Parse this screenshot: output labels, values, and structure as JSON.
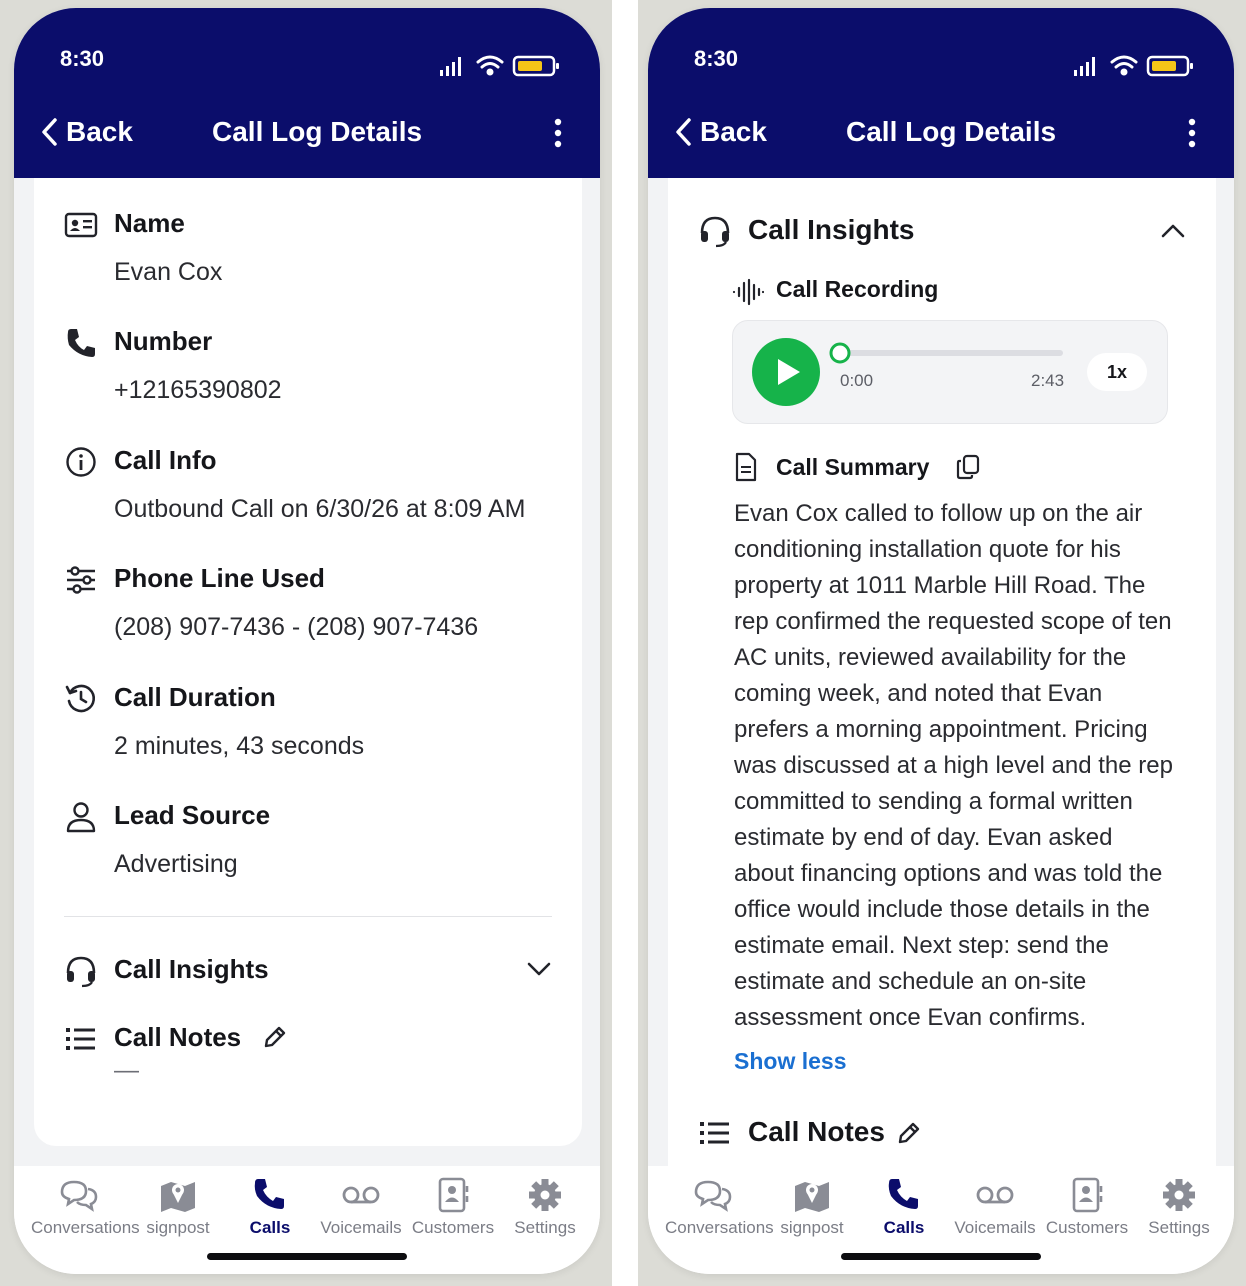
{
  "status": {
    "time": "8:30"
  },
  "nav": {
    "back_label": "Back",
    "title": "Call Log Details"
  },
  "details": {
    "name": {
      "label": "Name",
      "value": "Evan Cox"
    },
    "number": {
      "label": "Number",
      "value": "+12165390802"
    },
    "call_info": {
      "label": "Call Info",
      "value": "Outbound Call on 6/30/26 at 8:09 AM"
    },
    "phone_line": {
      "label": "Phone Line Used",
      "value": "(208) 907-7436 - (208) 907-7436"
    },
    "duration": {
      "label": "Call Duration",
      "value": "2 minutes, 43 seconds"
    },
    "lead_source": {
      "label": "Lead Source",
      "value": "Advertising"
    }
  },
  "insights": {
    "title": "Call Insights",
    "recording_label": "Call Recording",
    "player": {
      "current": "0:00",
      "total": "2:43",
      "speed": "1x",
      "progress": 0
    },
    "summary_label": "Call Summary",
    "summary_text": "Evan Cox called to follow up on the air conditioning installation quote for his property at 1011 Marble Hill Road. The rep confirmed the requested scope of ten AC units, reviewed availability for the coming week, and noted that Evan prefers a morning appointment. Pricing was discussed at a high level and the rep committed to sending a formal written estimate by end of day. Evan asked about financing options and was told the office would include those details in the estimate email. Next step: send the estimate and schedule an on-site assessment once Evan confirms.",
    "show_less": "Show less"
  },
  "notes": {
    "title": "Call Notes",
    "value": "—"
  },
  "tabs": [
    {
      "label": "Conversations",
      "icon": "conversations-icon"
    },
    {
      "label": "signpost",
      "icon": "map-icon"
    },
    {
      "label": "Calls",
      "icon": "phone-icon"
    },
    {
      "label": "Voicemails",
      "icon": "voicemail-icon"
    },
    {
      "label": "Customers",
      "icon": "contacts-icon"
    },
    {
      "label": "Settings",
      "icon": "gear-icon"
    }
  ],
  "colors": {
    "header": "#0b0d6b",
    "accent_green": "#16b34a",
    "link": "#1a6fd1",
    "battery": "#f5c518"
  }
}
